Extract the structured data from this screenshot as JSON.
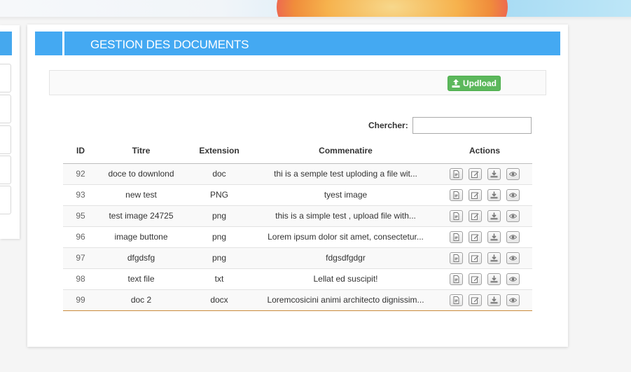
{
  "header": {
    "title": "GESTION DES DOCUMENTS"
  },
  "upload": {
    "label": "Updload",
    "icon": "upload-icon"
  },
  "search": {
    "label": "Chercher:",
    "value": ""
  },
  "table": {
    "columns": [
      "ID",
      "Titre",
      "Extension",
      "Commenatire",
      "Actions"
    ],
    "rows": [
      {
        "id": "92",
        "titre": "doce to downlond",
        "extension": "doc",
        "commentaire": "thi is a semple test uploding a file wit..."
      },
      {
        "id": "93",
        "titre": "new test",
        "extension": "PNG",
        "commentaire": "tyest image"
      },
      {
        "id": "95",
        "titre": "test image 24725",
        "extension": "png",
        "commentaire": "this is a simple test , upload file with..."
      },
      {
        "id": "96",
        "titre": "image buttone",
        "extension": "png",
        "commentaire": "Lorem ipsum dolor sit amet, consectetur..."
      },
      {
        "id": "97",
        "titre": "dfgdsfg",
        "extension": "png",
        "commentaire": "fdgsdfgdgr"
      },
      {
        "id": "98",
        "titre": "text file",
        "extension": "txt",
        "commentaire": "Lellat ed suscipit!"
      },
      {
        "id": "99",
        "titre": "doc 2",
        "extension": "docx",
        "commentaire": "Loremcosicini animi architecto dignissim..."
      }
    ],
    "row_actions": [
      "details-icon",
      "edit-icon",
      "download-icon",
      "view-icon"
    ]
  },
  "colors": {
    "header": "#44a9f2",
    "upload_button": "#5cb85c",
    "table_bottom_border": "#c98a3b"
  }
}
